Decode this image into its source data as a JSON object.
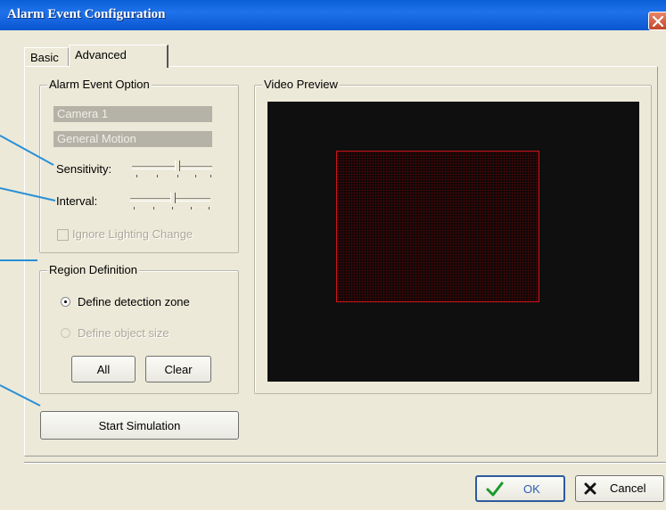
{
  "window": {
    "title": "Alarm Event Configuration"
  },
  "tabs": [
    {
      "label": "Basic"
    },
    {
      "label": "Advanced"
    }
  ],
  "alarm_event_option": {
    "legend": "Alarm Event Option",
    "camera": "Camera 1",
    "event_type": "General Motion",
    "sensitivity_label": "Sensitivity:",
    "sensitivity_level": 0.45,
    "interval_label": "Interval:",
    "interval_level": 0.45,
    "ignore_lighting_label": "Ignore Lighting Change",
    "ignore_lighting_checked": false
  },
  "region_definition": {
    "legend": "Region Definition",
    "option_zone": "Define detection zone",
    "option_size": "Define object size",
    "selected": "zone",
    "all_button": "All",
    "clear_button": "Clear"
  },
  "video_preview": {
    "legend": "Video Preview"
  },
  "start_simulation": "Start Simulation",
  "footer": {
    "ok": "OK",
    "cancel": "Cancel"
  },
  "colors": {
    "zone_border": "#d0151b",
    "callout_line": "#2a8fd6",
    "titlebar": "#0a5fd8"
  },
  "icons": {
    "close": "close-icon",
    "ok": "checkmark-icon",
    "cancel": "x-icon"
  }
}
